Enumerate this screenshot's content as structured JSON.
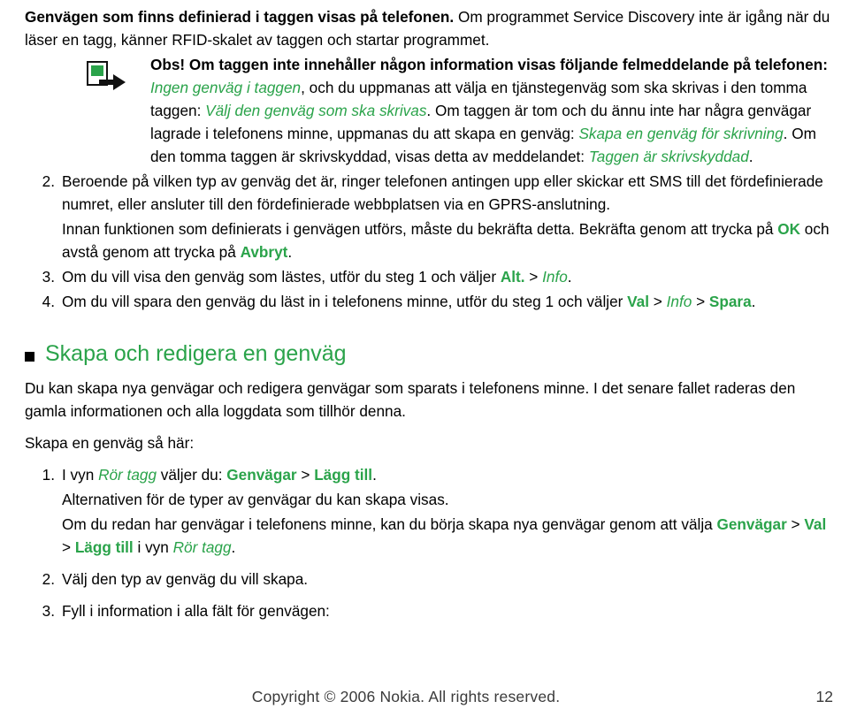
{
  "document": {
    "intro": {
      "line1_a": "Genvägen som finns definierad i taggen visas på telefonen. ",
      "line1_b": "Om programmet Service Discovery inte är igång när du läser en tagg, känner RFID-skalet av taggen och startar programmet."
    },
    "obs": {
      "label": "Obs!",
      "text_1": " Om taggen inte innehåller någon information visas följande felmeddelande på telefonen: ",
      "em_1": "Ingen genväg i taggen",
      "text_2": ", och du uppmanas att välja en tjänstegenväg som ska skrivas i den tomma taggen: ",
      "em_2": "Välj den genväg som ska skrivas",
      "text_3": ". Om taggen är tom och du ännu inte har några genvägar lagrade i telefonens minne, uppmanas du att skapa en genväg: ",
      "em_3": "Skapa en genväg för skrivning",
      "text_4": ". Om den tomma taggen är skrivskyddad, visas detta av meddelandet: ",
      "em_4": "Taggen är skrivskyddad",
      "text_5": "."
    },
    "steps": [
      {
        "num": "2.",
        "text_1": "Beroende på vilken typ av genväg det är, ringer telefonen antingen upp eller skickar ett SMS till det fördefinierade numret, eller ansluter till den fördefinierade webbplatsen via en GPRS-anslutning."
      },
      {
        "num": "3.",
        "text_1": "Om du vill visa den genväg som lästes, utför du steg 1 och väljer ",
        "b_1": "Alt.",
        "text_2": " > ",
        "em_1": "Info",
        "text_3": "."
      },
      {
        "num": "4.",
        "text_1": "Om du vill spara den genväg du läst in i telefonens minne, utför du steg 1 och väljer ",
        "b_1": "Val",
        "text_2": " > ",
        "em_1": "Info",
        "text_3": " > ",
        "b_2": "Spara",
        "text_4": "."
      }
    ],
    "step2_sub": {
      "text_1": "Innan funktionen som definierats i genvägen utförs, måste du bekräfta detta. Bekräfta genom att trycka på ",
      "b_1": "OK",
      "text_2": " och avstå genom att trycka på ",
      "b_2": "Avbryt",
      "text_3": "."
    },
    "section": {
      "heading": "Skapa och redigera en genväg",
      "para_1": "Du kan skapa nya genvägar och redigera genvägar som sparats i telefonens minne. I det senare fallet raderas den gamla informationen och alla loggdata som tillhör denna.",
      "para_2": "Skapa en genväg så här:"
    },
    "section_steps": [
      {
        "num": "1.",
        "text_1": "I vyn ",
        "em_1": "Rör tagg",
        "text_2": " väljer du: ",
        "b_1": "Genvägar",
        "text_3": " > ",
        "b_2": "Lägg till",
        "text_4": "."
      },
      {
        "num": "2.",
        "text_1": "Välj den typ av genväg du vill skapa."
      },
      {
        "num": "3.",
        "text_1": "Fyll i information i alla fält för genvägen:"
      }
    ],
    "section_step1_subs": {
      "sub_a": "Alternativen för de typer av genvägar du kan skapa visas.",
      "sub_b_text1": "Om du redan har genvägar i telefonens minne, kan du börja skapa nya genvägar genom att välja ",
      "sub_b_b1": "Genvägar",
      "sub_b_text2": " > ",
      "sub_b_b2": "Val",
      "sub_b_text3": " > ",
      "sub_b_b3": "Lägg till",
      "sub_b_text4": " i vyn ",
      "sub_b_em1": "Rör tagg",
      "sub_b_text5": "."
    },
    "footer": {
      "copyright": "Copyright © 2006 Nokia. All rights reserved.",
      "page_number": "12"
    },
    "colors": {
      "accent_green": "#2aa34a",
      "text": "#000000",
      "footer_text": "#3a3a3a"
    }
  }
}
